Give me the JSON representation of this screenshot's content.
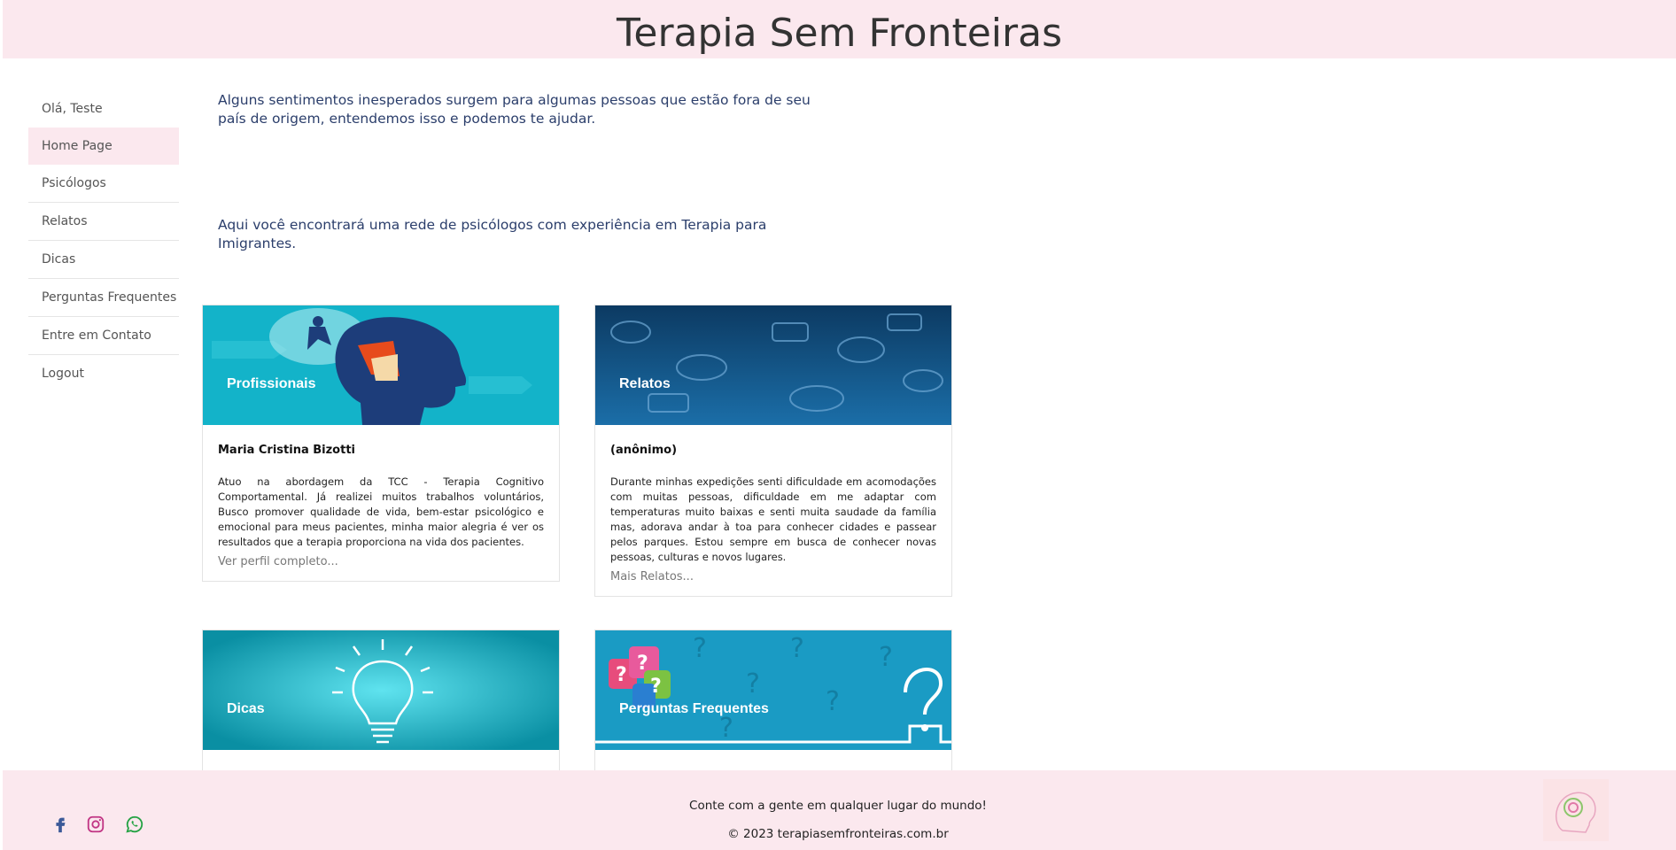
{
  "header": {
    "title": "Terapia Sem Fronteiras"
  },
  "sidebar": {
    "greeting": "Olá, Teste",
    "items": [
      {
        "label": "Home Page"
      },
      {
        "label": "Psicólogos"
      },
      {
        "label": "Relatos"
      },
      {
        "label": "Dicas"
      },
      {
        "label": "Perguntas Frequentes"
      },
      {
        "label": "Entre em Contato"
      },
      {
        "label": "Logout"
      }
    ],
    "active": "Home Page"
  },
  "intro": {
    "p1": "Alguns sentimentos inesperados surgem para algumas pessoas que estão fora de seu país de origem, entendemos isso e podemos te ajudar.",
    "p2": "Aqui você encontrará uma rede de psicólogos com experiência em Terapia para Imigrantes."
  },
  "cards": [
    {
      "title": "Profissionais",
      "name": "Maria Cristina Bizotti",
      "text": "Atuo na abordagem da TCC - Terapia Cognitivo Comportamental. Já realizei muitos trabalhos voluntários, Busco promover qualidade de vida, bem-estar psicológico e emocional para meus pacientes, minha maior alegria é ver os resultados que a terapia proporciona na vida dos pacientes.",
      "link": "Ver perfil completo..."
    },
    {
      "title": "Relatos",
      "name": "(anônimo)",
      "text": "Durante minhas expedições senti dificuldade em acomodações com muitas pessoas, dificuldade em me adaptar com temperaturas muito baixas e senti muita saudade da família mas, adorava andar à toa para conhecer cidades e passear pelos parques. Estou sempre em busca de conhecer novas pessoas, culturas e novos lugares.",
      "link": "Mais Relatos..."
    },
    {
      "title": "Dicas"
    },
    {
      "title": "Perguntas Frequentes"
    }
  ],
  "footer": {
    "tagline": "Conte com a gente em qualquer lugar do mundo!",
    "copyright": "© 2023 terapiasemfronteiras.com.br",
    "social": [
      "facebook-icon",
      "instagram-icon",
      "whatsapp-icon"
    ]
  },
  "colors": {
    "header_bg": "#fbe8ee",
    "intro_text": "#2b3e6b",
    "facebook": "#3b5998",
    "instagram": "#c13584",
    "whatsapp": "#25a244"
  }
}
